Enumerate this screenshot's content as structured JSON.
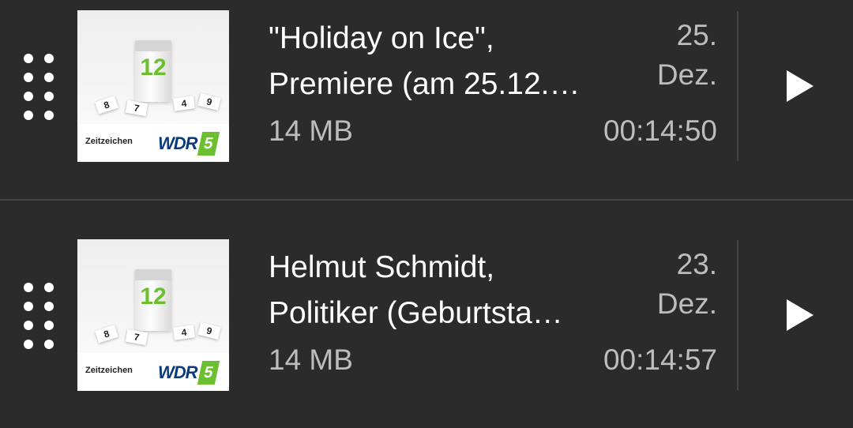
{
  "episodes": [
    {
      "title_line1": "\"Holiday on Ice\",",
      "title_line2": "Premiere (am 25.12.…",
      "size": "14 MB",
      "date_day": "25.",
      "date_month": "Dez.",
      "duration": "00:14:50",
      "cover": {
        "series": "Zeitzeichen",
        "station": "WDR",
        "station_number": "5",
        "calendar_number": "12"
      },
      "play_icon": "play-icon",
      "drag_icon": "drag-handle-icon"
    },
    {
      "title_line1": "Helmut Schmidt,",
      "title_line2": "Politiker (Geburtsta…",
      "size": "14 MB",
      "date_day": "23.",
      "date_month": "Dez.",
      "duration": "00:14:57",
      "cover": {
        "series": "Zeitzeichen",
        "station": "WDR",
        "station_number": "5",
        "calendar_number": "12"
      },
      "play_icon": "play-icon",
      "drag_icon": "drag-handle-icon"
    }
  ],
  "colors": {
    "background": "#2b2b2b",
    "primary_text": "#ffffff",
    "secondary_text": "#bdbdbd",
    "divider": "#444444",
    "wdr_green": "#6cbf2e",
    "wdr_blue": "#0a3a7a"
  }
}
